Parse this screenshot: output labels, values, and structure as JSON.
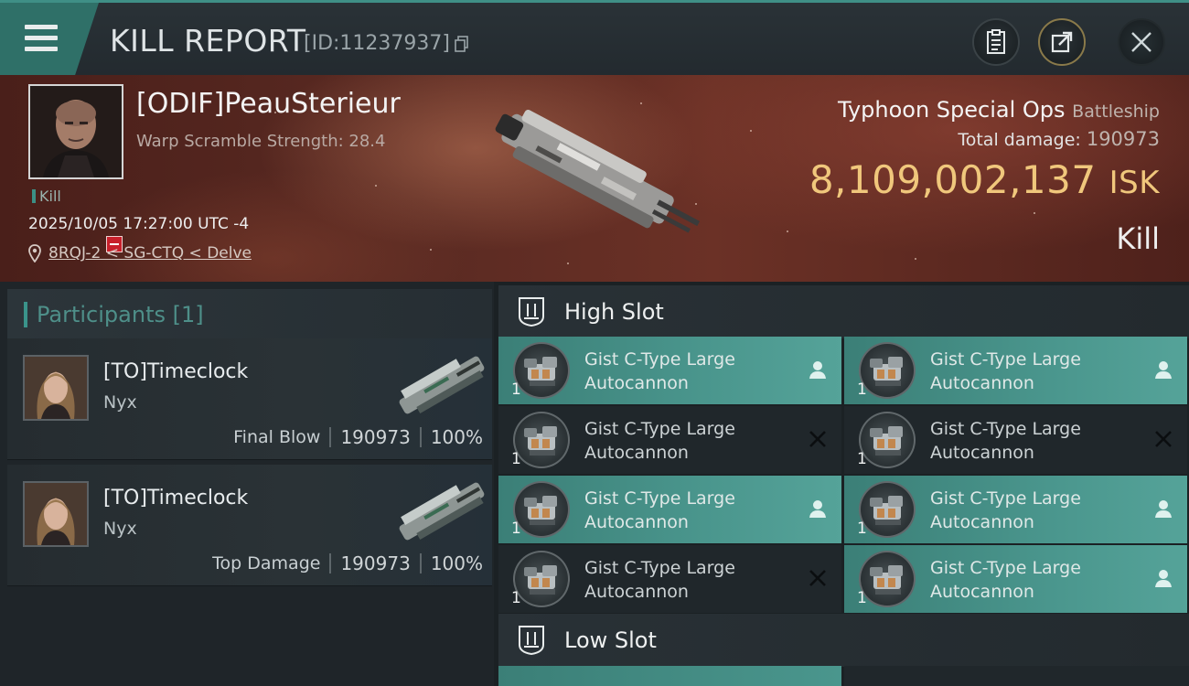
{
  "header": {
    "title": "KILL REPORT",
    "report_id": "[ID:11237937]",
    "icons": [
      "menu-icon",
      "copy-icon",
      "clipboard-icon",
      "share-icon",
      "close-icon"
    ]
  },
  "victim": {
    "name": "[ODIF]PeauSterieur",
    "warp_scramble": "Warp Scramble Strength: 28.4",
    "tag": "Kill",
    "datetime": "2025/10/05 17:27:00 UTC -4",
    "location": "8RQJ-2 < SG-CTQ < Delve",
    "ship_name": "Typhoon Special Ops",
    "ship_class": "Battleship",
    "total_damage_label": "Total damage:",
    "total_damage": "190973",
    "isk_value": "8,109,002,137",
    "isk_unit": "ISK",
    "result": "Kill"
  },
  "participants": {
    "title": "Participants",
    "count": "[1]",
    "cards": [
      {
        "name": "[TO]Timeclock",
        "ship": "Nyx",
        "role": "Final Blow",
        "damage": "190973",
        "percent": "100%"
      },
      {
        "name": "[TO]Timeclock",
        "ship": "Nyx",
        "role": "Top Damage",
        "damage": "190973",
        "percent": "100%"
      }
    ]
  },
  "fittings": {
    "high_slot": {
      "label": "High Slot",
      "modules": [
        {
          "name": "Gist C-Type Large Autocannon",
          "qty": "1",
          "state": "active"
        },
        {
          "name": "Gist C-Type Large Autocannon",
          "qty": "1",
          "state": "active"
        },
        {
          "name": "Gist C-Type Large Autocannon",
          "qty": "1",
          "state": "destroyed"
        },
        {
          "name": "Gist C-Type Large Autocannon",
          "qty": "1",
          "state": "destroyed"
        },
        {
          "name": "Gist C-Type Large Autocannon",
          "qty": "1",
          "state": "active"
        },
        {
          "name": "Gist C-Type Large Autocannon",
          "qty": "1",
          "state": "active"
        },
        {
          "name": "Gist C-Type Large Autocannon",
          "qty": "1",
          "state": "destroyed"
        },
        {
          "name": "Gist C-Type Large Autocannon",
          "qty": "1",
          "state": "active"
        }
      ]
    },
    "low_slot": {
      "label": "Low Slot"
    }
  },
  "colors": {
    "accent": "#3f8f86",
    "isk": "#f0c77c",
    "active_module": "#4a968d",
    "inactive_module": "#20272b"
  }
}
